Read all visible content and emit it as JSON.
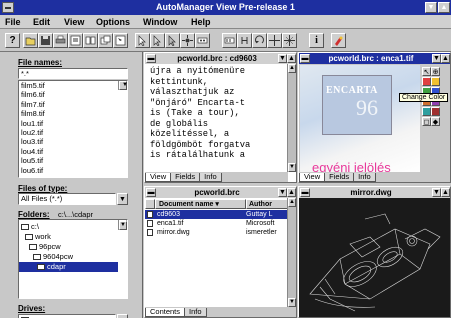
{
  "app": {
    "title": "AutoManager View Pre-release 1"
  },
  "menu": [
    "File",
    "Edit",
    "View",
    "Options",
    "Window",
    "Help"
  ],
  "colors": {
    "titlebar": "#1e2fa0",
    "selection": "#1e2fa0",
    "encarta_text": "#e8389a",
    "face": "#c8c8c8"
  },
  "toolbar": {
    "icons": [
      "help-icon",
      "open-icon",
      "save-icon",
      "print-icon",
      "view-icon",
      "thumbnail-icon",
      "copy-icon",
      "pointer-icon",
      "select-icon",
      "link-icon",
      "move-icon",
      "grid-icon",
      "measure-icon",
      "rotate-icon",
      "zoom-fit-icon",
      "zoom-icon",
      "info-icon",
      "paint-icon"
    ]
  },
  "left": {
    "file_names_label": "File names:",
    "file_names_value": "*.*",
    "files": [
      "film5.tif",
      "film6.tif",
      "film7.tif",
      "film8.tif",
      "lou1.tif",
      "lou2.tif",
      "lou3.tif",
      "lou4.tif",
      "lou5.tif",
      "lou6.tif"
    ],
    "files_of_type_label": "Files of type:",
    "files_of_type_value": "All Files (*.*)",
    "folders_label": "Folders:",
    "folders_value": "c:\\...\\cdapr",
    "folders": [
      "c:\\",
      "work",
      "96pcw",
      "9604pcw",
      "cdapr"
    ],
    "drives_label": "Drives:",
    "drives_value": "c:"
  },
  "panes": {
    "text": {
      "title": "pcworld.brc : cd9603",
      "lines": [
        "újra a nyitómenüre",
        "kettintunk,",
        "választhatjuk az",
        "\"önjáró\" Encarta-t",
        "is (Take a tour),",
        "de globális",
        "közelítéssel, a",
        "földgömböt forgatva",
        "is rátalálhatunk a"
      ],
      "tabs": [
        "View",
        "Fields",
        "Info"
      ]
    },
    "image": {
      "title": "pcworld.brc : enca1.tif",
      "encarta": "ENCARTA",
      "big_text": "egyéni jelölés",
      "tooltip": "Change Color",
      "tabs": [
        "View",
        "Fields",
        "Info"
      ]
    },
    "list": {
      "title": "pcworld.brc",
      "columns": [
        "Document name",
        "Author"
      ],
      "rows": [
        {
          "name": "cd9603",
          "author": "Guttay L"
        },
        {
          "name": "enca1.tif",
          "author": "Microsoft"
        },
        {
          "name": "mirror.dwg",
          "author": "ismeretler"
        }
      ],
      "tabs": [
        "Contents",
        "Info"
      ]
    },
    "cad": {
      "title": "mirror.dwg"
    }
  }
}
